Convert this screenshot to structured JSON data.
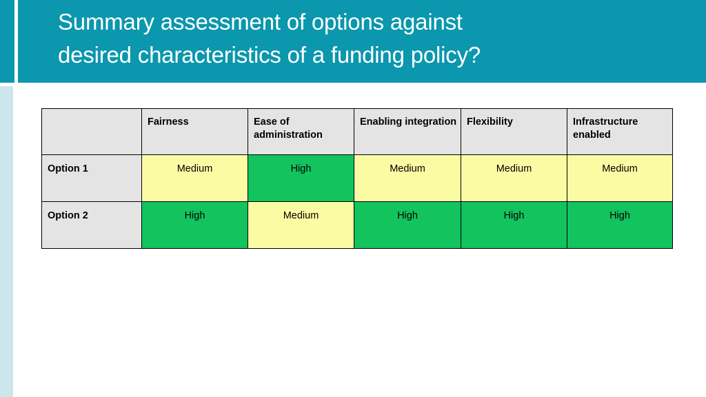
{
  "slide": {
    "title": "Summary assessment of options against\ndesired characteristics of a funding policy?",
    "banner_color": "#0b97ad",
    "accent_strip_color": "#cbe7ec"
  },
  "table": {
    "corner_label": "",
    "columns": [
      "Fairness",
      "Ease of\nadministration",
      "Enabling\nintegration",
      "Flexibility",
      "Infrastructure\nenabled"
    ],
    "rows": [
      {
        "label": "Option 1",
        "cells": [
          {
            "value": "Medium",
            "rating": "medium",
            "color": "#fbfba4"
          },
          {
            "value": "High",
            "rating": "high",
            "color": "#12c35e"
          },
          {
            "value": "Medium",
            "rating": "medium",
            "color": "#fbfba4"
          },
          {
            "value": "Medium",
            "rating": "medium",
            "color": "#fbfba4"
          },
          {
            "value": "Medium",
            "rating": "medium",
            "color": "#fbfba4"
          }
        ]
      },
      {
        "label": "Option 2",
        "cells": [
          {
            "value": "High",
            "rating": "high",
            "color": "#12c35e"
          },
          {
            "value": "Medium",
            "rating": "medium",
            "color": "#fbfba4"
          },
          {
            "value": "High",
            "rating": "high",
            "color": "#12c35e"
          },
          {
            "value": "High",
            "rating": "high",
            "color": "#12c35e"
          },
          {
            "value": "High",
            "rating": "high",
            "color": "#12c35e"
          }
        ]
      }
    ],
    "header_background": "#e4e4e4",
    "row_label_background": "#e4e4e4"
  }
}
